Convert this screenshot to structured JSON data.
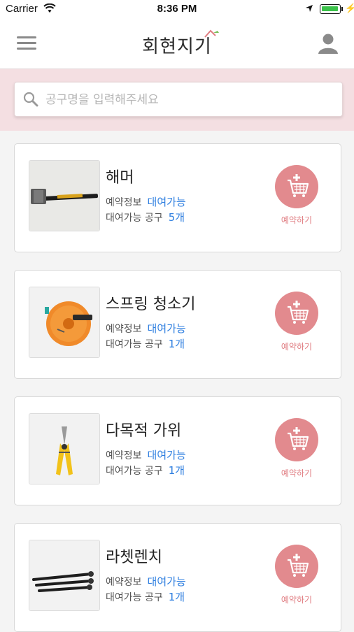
{
  "status_bar": {
    "carrier": "Carrier",
    "time": "8:36 PM"
  },
  "header": {
    "title": "회현지기",
    "menu_icon": "hamburger-menu-icon",
    "user_icon": "user-profile-icon"
  },
  "search": {
    "placeholder": "공구명을 입력해주세요",
    "value": ""
  },
  "labels": {
    "reservation_info": "예약정보",
    "available_tools": "대여가능 공구",
    "reserve_button": "예약하기"
  },
  "tools": [
    {
      "name": "해머",
      "status": "대여가능",
      "count": "5개",
      "image": "hammer"
    },
    {
      "name": "스프링 청소기",
      "status": "대여가능",
      "count": "1개",
      "image": "spring-cleaner"
    },
    {
      "name": "다목적 가위",
      "status": "대여가능",
      "count": "1개",
      "image": "multipurpose-scissors"
    },
    {
      "name": "라쳇렌치",
      "status": "대여가능",
      "count": "1개",
      "image": "ratchet-wrench"
    }
  ],
  "colors": {
    "accent_pink": "#e28a8e",
    "search_band": "#f4dfe2",
    "value_blue": "#2f7fe0"
  }
}
